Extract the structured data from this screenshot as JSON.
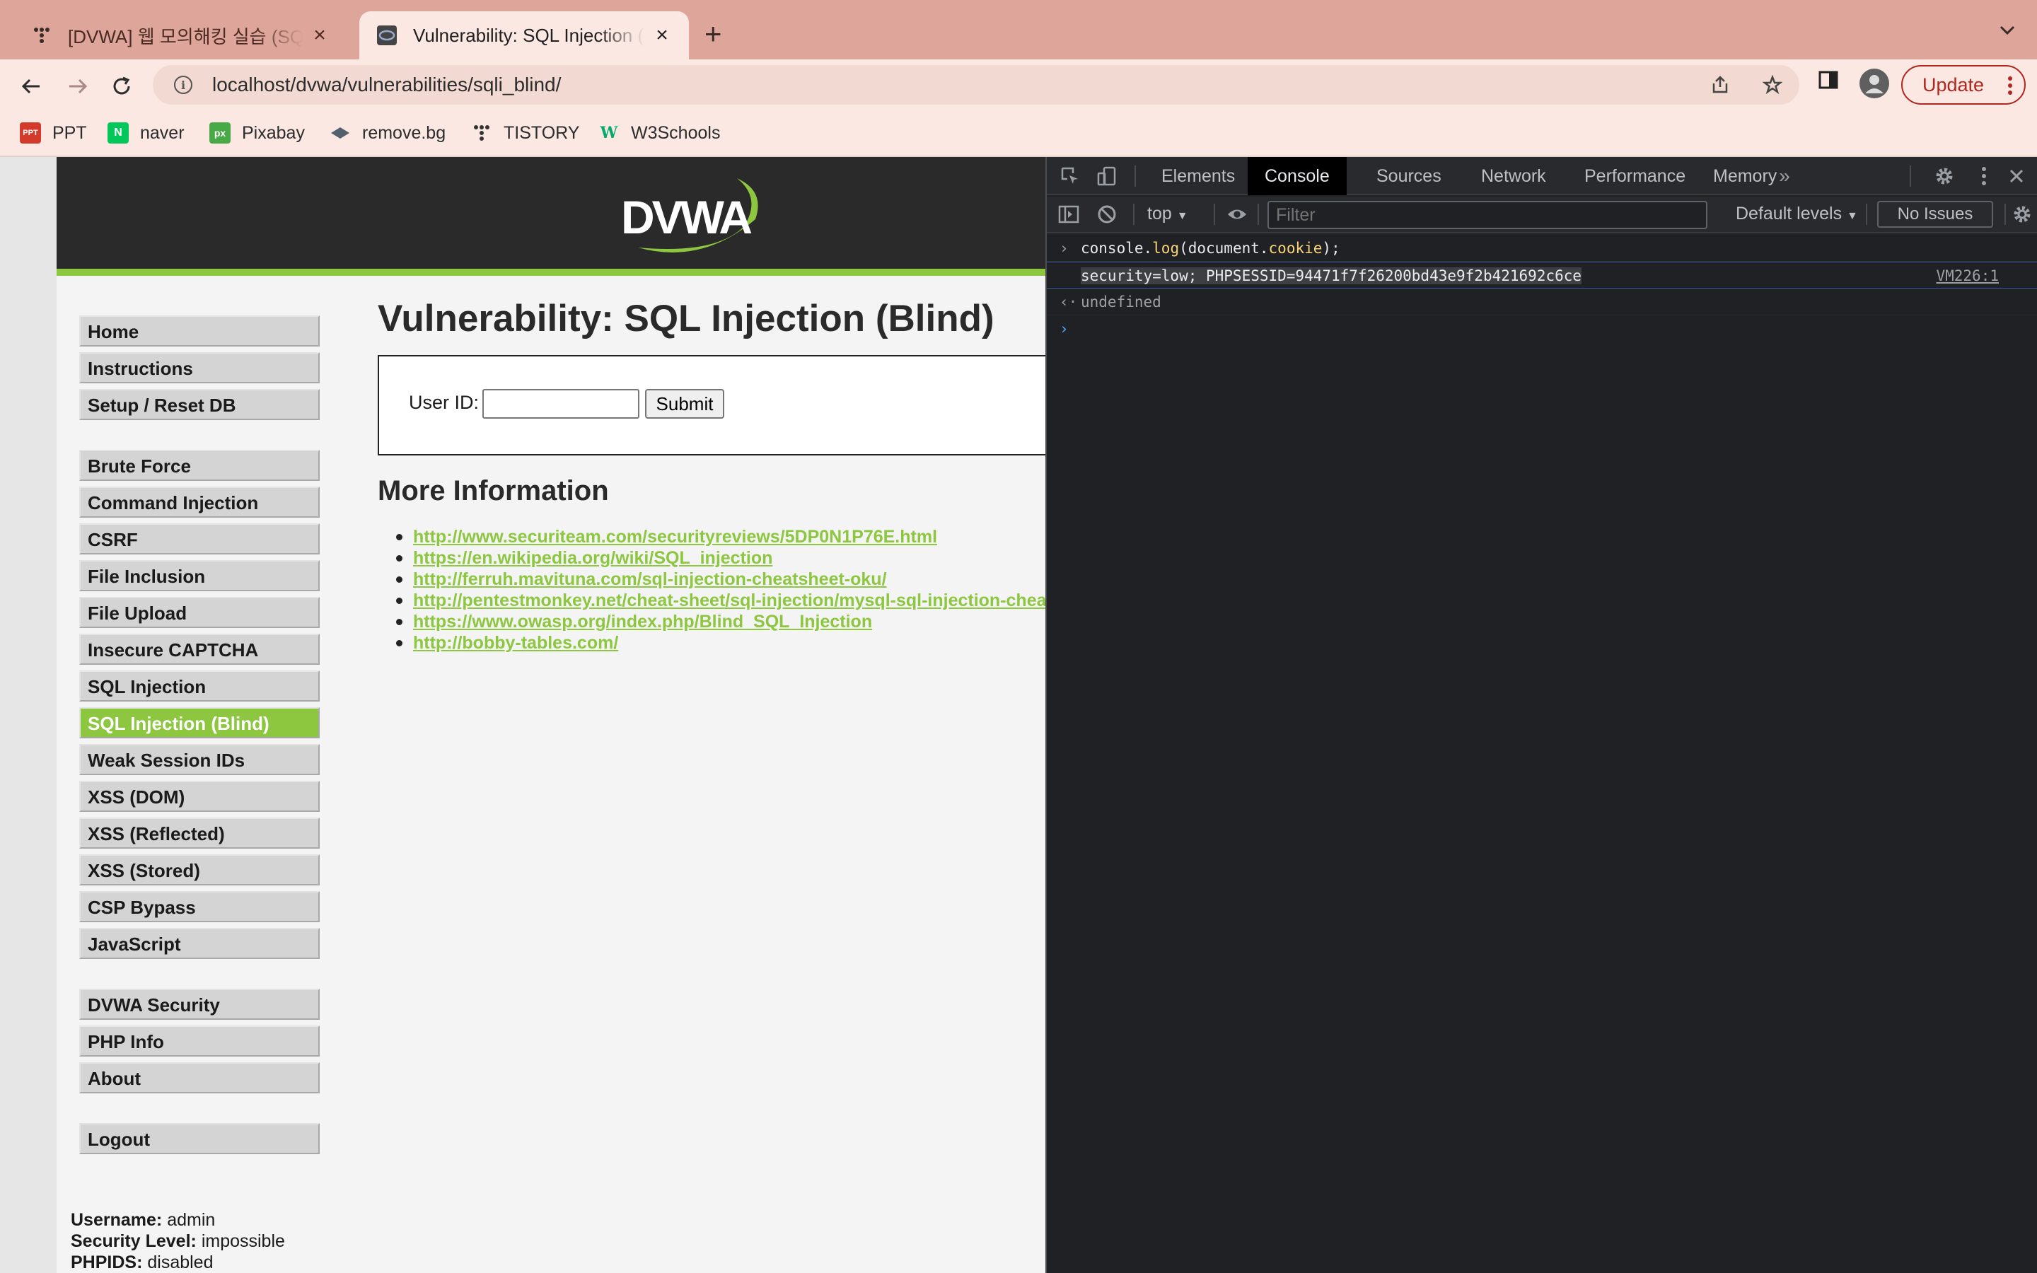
{
  "browser": {
    "tabs": [
      {
        "title": "[DVWA] 웹 모의해킹 실습 (SQL Injection)",
        "active": false
      },
      {
        "title": "Vulnerability: SQL Injection (Blind)",
        "active": true
      }
    ],
    "url": "localhost/dvwa/vulnerabilities/sqli_blind/",
    "update_label": "Update",
    "bookmarks": [
      {
        "label": "PPT",
        "icon": "ppt-icon",
        "color": "#d33a2c"
      },
      {
        "label": "naver",
        "icon": "naver-icon",
        "color": "#03c75a"
      },
      {
        "label": "Pixabay",
        "icon": "pixabay-icon",
        "color": "#48a947"
      },
      {
        "label": "remove.bg",
        "icon": "removebg-icon",
        "color": "#54616c"
      },
      {
        "label": "TISTORY",
        "icon": "tistory-icon",
        "color": "#333333"
      },
      {
        "label": "W3Schools",
        "icon": "w3schools-icon",
        "color": "#04aa6d"
      }
    ]
  },
  "dvwa": {
    "logo_text": "DVWA",
    "title": "Vulnerability: SQL Injection (Blind)",
    "user_id_label": "User ID:",
    "user_id_value": "",
    "submit_label": "Submit",
    "more_info_heading": "More Information",
    "links": [
      "http://www.securiteam.com/securityreviews/5DP0N1P76E.html",
      "https://en.wikipedia.org/wiki/SQL_injection",
      "http://ferruh.mavituna.com/sql-injection-cheatsheet-oku/",
      "http://pentestmonkey.net/cheat-sheet/sql-injection/mysql-sql-injection-cheat-sheet",
      "https://www.owasp.org/index.php/Blind_SQL_Injection",
      "http://bobby-tables.com/"
    ],
    "menu": {
      "group1": [
        "Home",
        "Instructions",
        "Setup / Reset DB"
      ],
      "group2": [
        "Brute Force",
        "Command Injection",
        "CSRF",
        "File Inclusion",
        "File Upload",
        "Insecure CAPTCHA",
        "SQL Injection",
        "SQL Injection (Blind)",
        "Weak Session IDs",
        "XSS (DOM)",
        "XSS (Reflected)",
        "XSS (Stored)",
        "CSP Bypass",
        "JavaScript"
      ],
      "group3": [
        "DVWA Security",
        "PHP Info",
        "About"
      ],
      "group4": [
        "Logout"
      ],
      "selected": "SQL Injection (Blind)"
    },
    "footer": {
      "username_label": "Username:",
      "username": "admin",
      "security_label": "Security Level:",
      "security": "impossible",
      "phpids_label": "PHPIDS:",
      "phpids": "disabled"
    },
    "accent_color": "#8dc63f"
  },
  "devtools": {
    "tabs": [
      "Elements",
      "Console",
      "Sources",
      "Network",
      "Performance",
      "Memory"
    ],
    "active_tab": "Console",
    "context": "top",
    "filter_placeholder": "Filter",
    "levels_label": "Default levels",
    "issues_label": "No Issues",
    "console": {
      "input_parts": [
        "console.",
        "log",
        "(document.",
        "cookie",
        ");"
      ],
      "output": "security=low; PHPSESSID=94471f7f26200bd43e9f2b421692c6ce",
      "output_source": "VM226:1",
      "return_value": "undefined"
    }
  }
}
